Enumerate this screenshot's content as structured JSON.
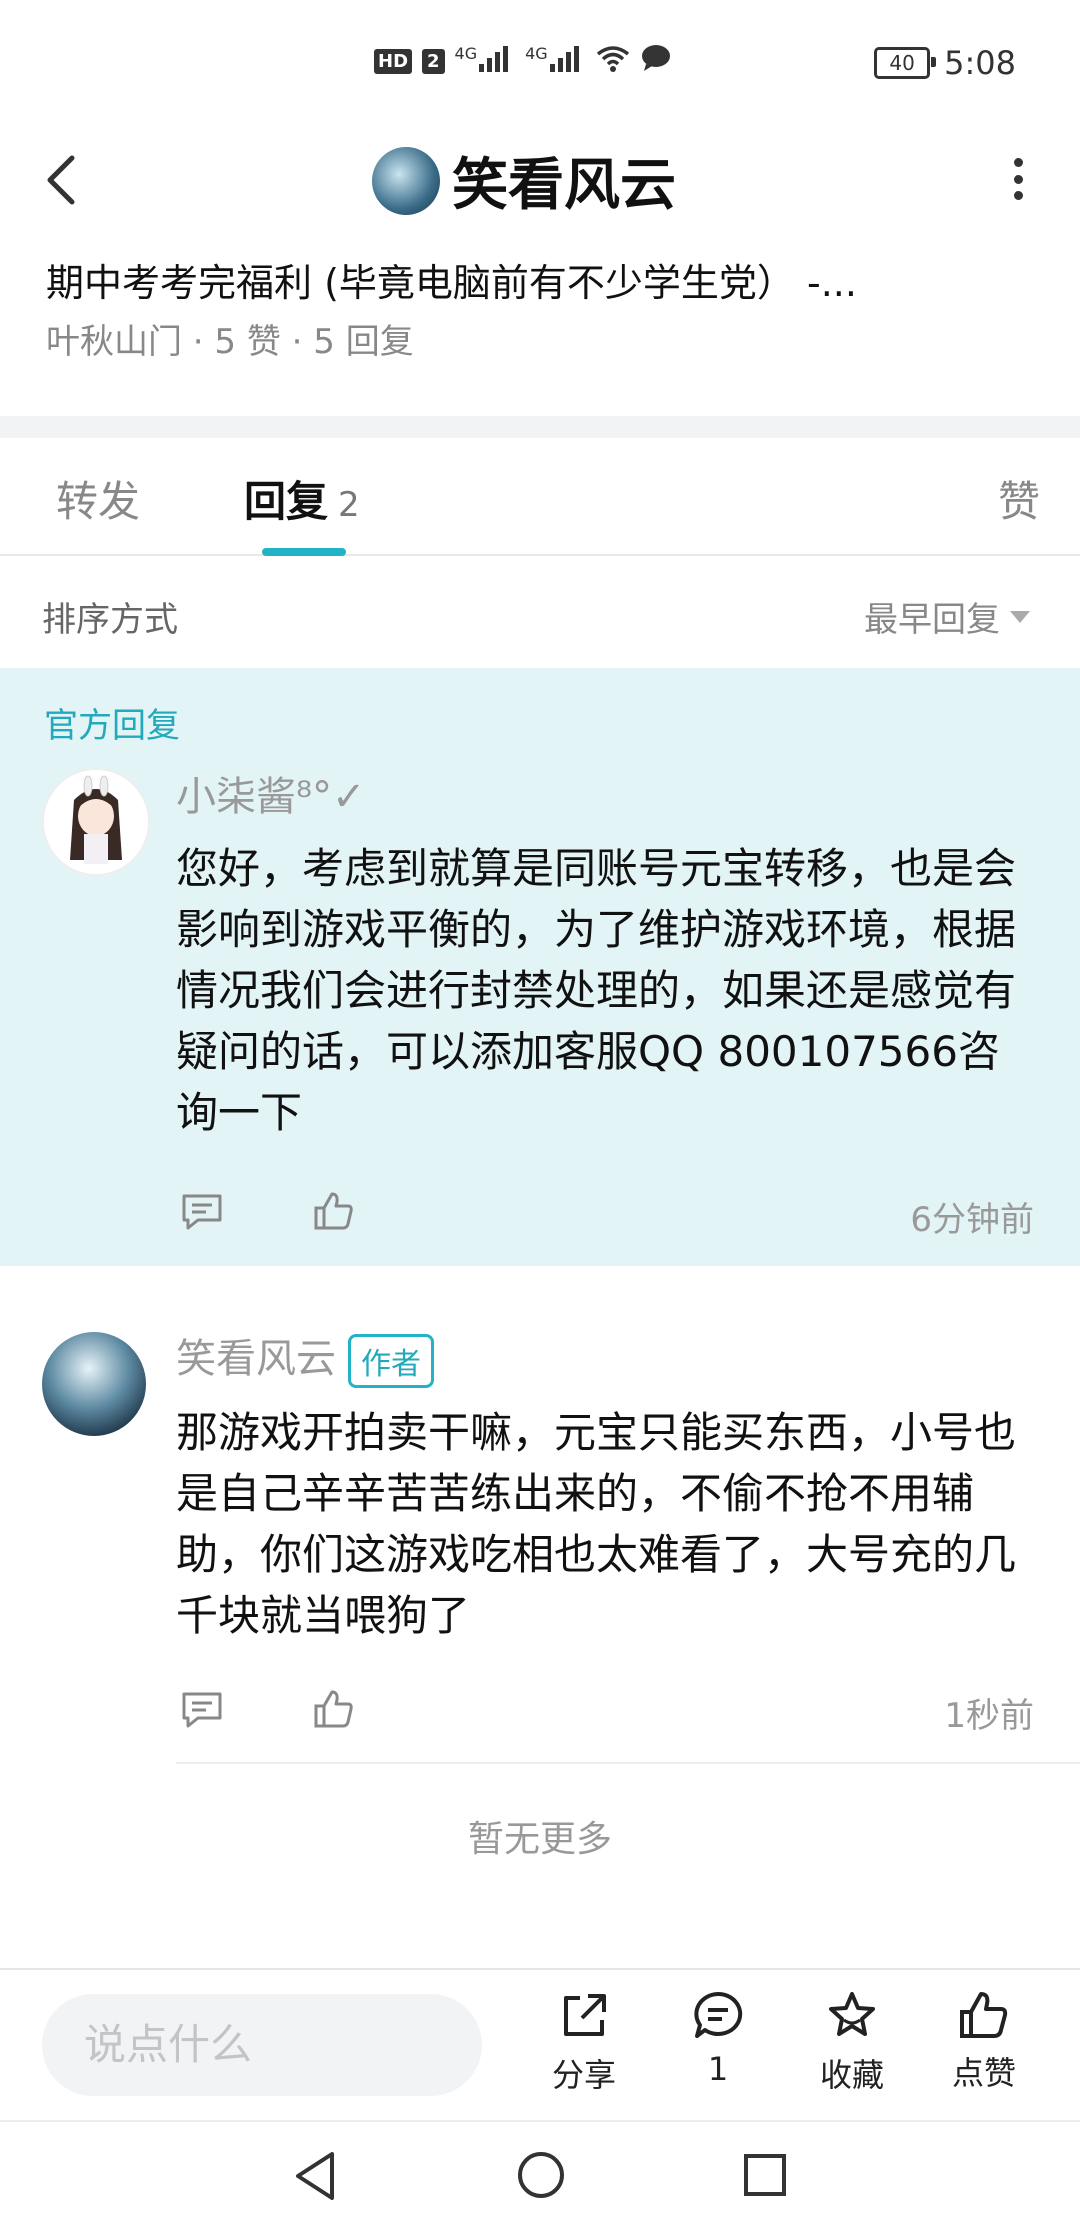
{
  "status_bar": {
    "network_badges": [
      "HD",
      "2",
      "4G",
      "4G"
    ],
    "battery": "40",
    "time": "5:08"
  },
  "header": {
    "title": "笑看风云",
    "post_title": "期中考考完福利 (毕竟电脑前有不少学生党）   -...",
    "post_meta": "叶秋山门 · 5 赞 · 5 回复"
  },
  "tabs": {
    "forward": "转发",
    "reply": "回复",
    "reply_count": "2",
    "like": "赞"
  },
  "sort": {
    "label": "排序方式",
    "value": "最早回复"
  },
  "official_reply": {
    "section_label": "官方回复",
    "username": "小柒酱⁸°✓",
    "text": "您好，考虑到就算是同账号元宝转移，也是会影响到游戏平衡的，为了维护游戏环境，根据情况我们会进行封禁处理的，如果还是感觉有疑问的话，可以添加客服QQ 800107566咨询一下",
    "time": "6分钟前"
  },
  "author_reply": {
    "username": "笑看风云",
    "badge": "作者",
    "text": "那游戏开拍卖干嘛，元宝只能买东西，小号也是自己辛辛苦苦练出来的，不偷不抢不用辅助，你们这游戏吃相也太难看了，大号充的几千块就当喂狗了",
    "time": "1秒前"
  },
  "no_more": "暂无更多",
  "bottom_bar": {
    "input_placeholder": "说点什么",
    "share": "分享",
    "comments": "1",
    "favorite": "收藏",
    "like": "点赞"
  },
  "colors": {
    "accent": "#22b3c6",
    "official_bg": "#e3f4f7"
  }
}
